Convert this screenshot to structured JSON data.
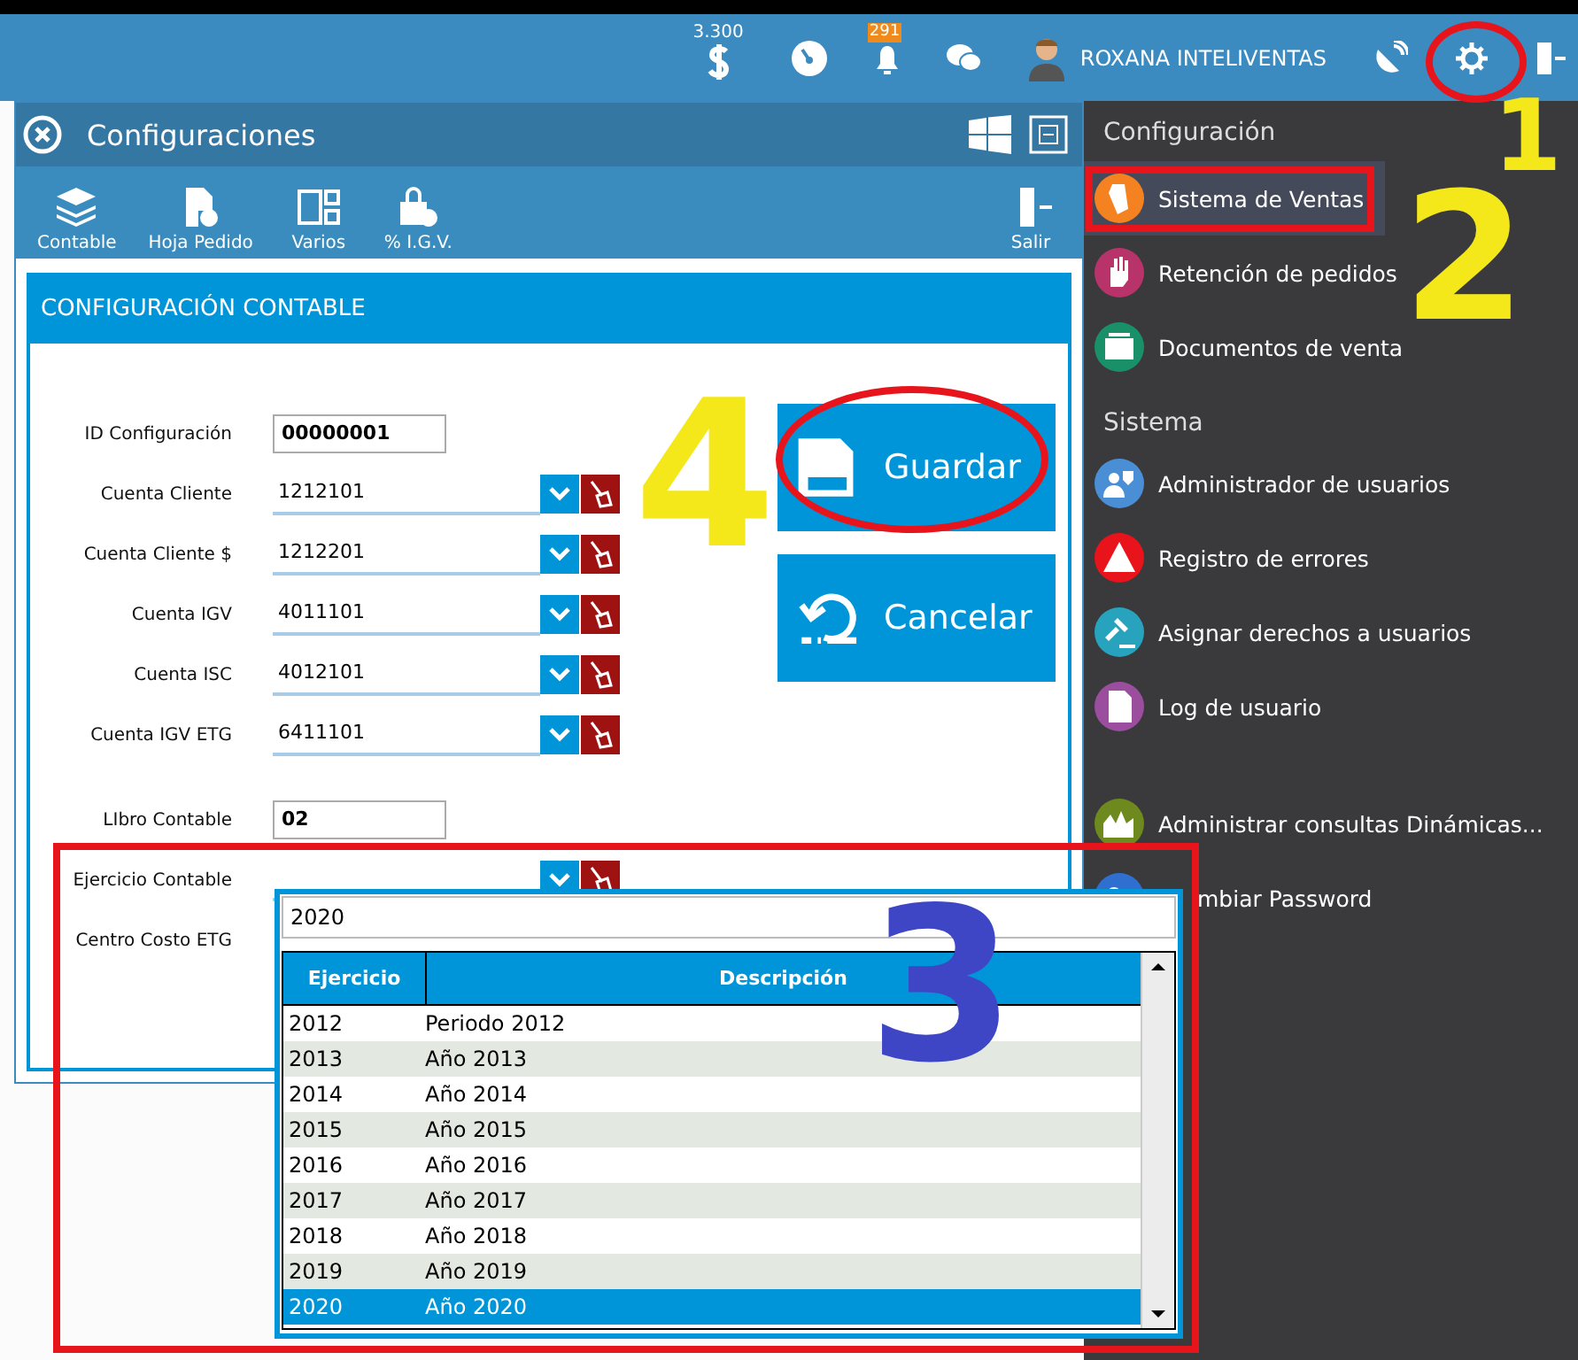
{
  "topbar": {
    "balance": "3.300",
    "notifications": "291",
    "user": "ROXANA INTELIVENTAS"
  },
  "window": {
    "title": "Configuraciones",
    "toolbar": [
      {
        "label": "Contable",
        "kind": "layers"
      },
      {
        "label": "Hoja Pedido",
        "kind": "document"
      },
      {
        "label": "Varios",
        "kind": "panels"
      },
      {
        "label": "% I.G.V.",
        "kind": "bag"
      },
      {
        "label": "Salir",
        "kind": "exit"
      }
    ],
    "section_title": "CONFIGURACIÓN CONTABLE",
    "fields": [
      {
        "label": "ID Configuración",
        "value": "00000001",
        "kind": "box"
      },
      {
        "label": "Cuenta Cliente",
        "value": "1212101",
        "kind": "combo"
      },
      {
        "label": "Cuenta Cliente $",
        "value": "1212201",
        "kind": "combo"
      },
      {
        "label": "Cuenta IGV",
        "value": "4011101",
        "kind": "combo"
      },
      {
        "label": "Cuenta ISC",
        "value": "4012101",
        "kind": "combo"
      },
      {
        "label": "Cuenta IGV ETG",
        "value": "6411101",
        "kind": "combo"
      },
      {
        "label": "LIbro Contable",
        "value": "02",
        "kind": "box"
      },
      {
        "label": "Ejercicio Contable",
        "kind": "combo"
      },
      {
        "label": "Centro Costo ETG",
        "kind": "covered"
      }
    ],
    "buttons": [
      {
        "label": "Guardar",
        "kind": "save"
      },
      {
        "label": "Cancelar",
        "kind": "undo"
      }
    ]
  },
  "popup": {
    "search": "2020",
    "columns": [
      "Ejercicio",
      "Descripción"
    ],
    "rows": [
      {
        "year": "2012",
        "description": "Periodo 2012",
        "selected": false
      },
      {
        "year": "2013",
        "description": "Año 2013",
        "selected": false
      },
      {
        "year": "2014",
        "description": "Año 2014",
        "selected": false
      },
      {
        "year": "2015",
        "description": "Año 2015",
        "selected": false
      },
      {
        "year": "2016",
        "description": "Año 2016",
        "selected": false
      },
      {
        "year": "2017",
        "description": "Año 2017",
        "selected": false
      },
      {
        "year": "2018",
        "description": "Año 2018",
        "selected": false
      },
      {
        "year": "2019",
        "description": "Año 2019",
        "selected": false
      },
      {
        "year": "2020",
        "description": "Año 2020",
        "selected": true
      }
    ]
  },
  "sidebar": [
    {
      "title": "Configuración",
      "items": [
        {
          "label": "Sistema de Ventas",
          "color": "#f58220",
          "selected": true
        },
        {
          "label": "Retención de pedidos",
          "color": "#b8336a",
          "selected": false
        },
        {
          "label": "Documentos de venta",
          "color": "#1a9068",
          "selected": false
        }
      ]
    },
    {
      "title": "Sistema",
      "items": [
        {
          "label": "Administrador de usuarios",
          "color": "#4a8fd6",
          "selected": false
        },
        {
          "label": "Registro de errores",
          "color": "#e8131b",
          "selected": false
        },
        {
          "label": "Asignar derechos a usuarios",
          "color": "#28a3bd",
          "selected": false
        },
        {
          "label": "Log de usuario",
          "color": "#9b4d9e",
          "selected": false
        }
      ]
    },
    {
      "items": [
        {
          "label": "Administrar consultas Dinámicas...",
          "color": "#6e8a1e",
          "selected": false
        },
        {
          "label": "mbiar Password",
          "color": "#2f6fd0",
          "selected": false,
          "clipped": true
        }
      ]
    }
  ],
  "annotations": [
    {
      "kind": "ellipse",
      "color": "#e8141c"
    },
    {
      "kind": "number",
      "label": "1",
      "color": "#f4e81a"
    },
    {
      "kind": "rect",
      "color": "#e8141c"
    },
    {
      "kind": "number",
      "label": "2",
      "color": "#f4e81a"
    },
    {
      "kind": "rect",
      "color": "#e8141c"
    },
    {
      "kind": "number",
      "label": "3",
      "color": "#3e46c6"
    },
    {
      "kind": "number",
      "label": "4",
      "color": "#f4e81a"
    },
    {
      "kind": "ellipse",
      "color": "#e8141c"
    }
  ]
}
